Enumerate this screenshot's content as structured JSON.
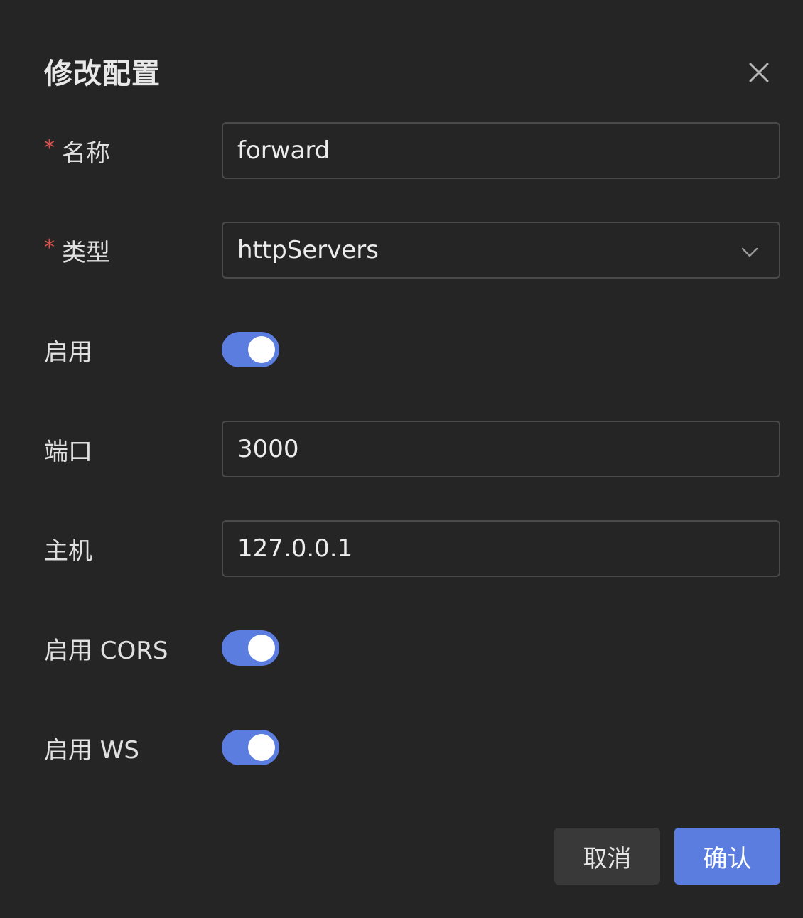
{
  "dialog": {
    "title": "修改配置"
  },
  "form": {
    "required_mark": "*",
    "name": {
      "label": "名称",
      "value": "forward",
      "required": true
    },
    "type": {
      "label": "类型",
      "value": "httpServers",
      "required": true
    },
    "enable": {
      "label": "启用",
      "checked": true
    },
    "port": {
      "label": "端口",
      "value": "3000"
    },
    "host": {
      "label": "主机",
      "value": "127.0.0.1"
    },
    "enable_cors": {
      "label": "启用 CORS",
      "checked": true
    },
    "enable_ws": {
      "label": "启用 WS",
      "checked": true
    }
  },
  "footer": {
    "cancel_label": "取消",
    "confirm_label": "确认"
  },
  "icons": {
    "close": "close-icon",
    "chevron": "chevron-down-icon"
  },
  "colors": {
    "background": "#252526",
    "accent": "#5b7de0",
    "required": "#e0504a",
    "input_border": "#4a4a4d",
    "cancel_bg": "#393939"
  }
}
